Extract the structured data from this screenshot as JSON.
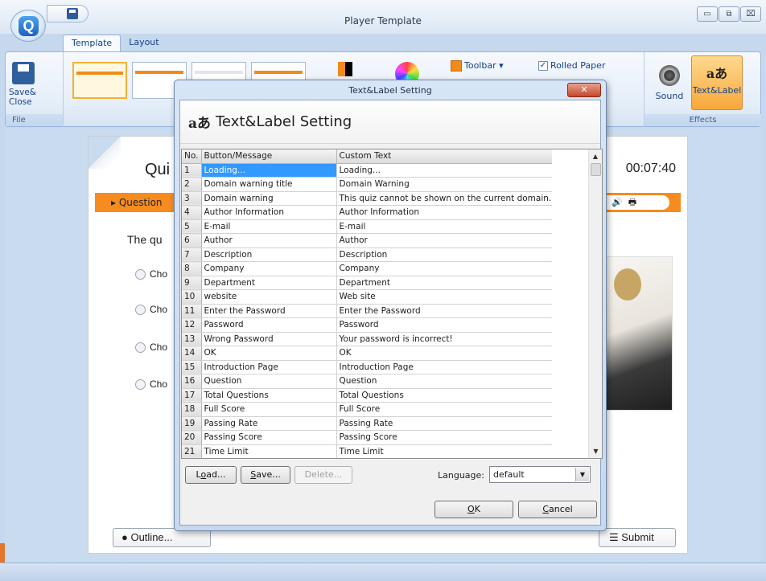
{
  "window": {
    "title": "Player Template",
    "controls": [
      "minimize",
      "restore",
      "close"
    ]
  },
  "ribbon": {
    "tabs": [
      "Template",
      "Layout"
    ],
    "active_tab": "Template",
    "file_group": {
      "label": "File",
      "save_close": "Save&\nClose"
    },
    "toolbar_label": "Toolbar",
    "rolled_paper": "Rolled Paper",
    "rolled_paper_checked": true,
    "effects_group": {
      "label": "Effects",
      "sound": "Sound",
      "text_label": "Text&Label"
    }
  },
  "player": {
    "title_partial": "Qui",
    "timer": "00:07:40",
    "question_partial": "Question",
    "question_text_partial": "The qu",
    "choices": [
      "Cho",
      "Cho",
      "Cho",
      "Cho"
    ],
    "outline_button": "Outline...",
    "submit_button": "Submit"
  },
  "dialog": {
    "window_title": "Text&Label Setting",
    "header_title": "Text&Label Setting",
    "header_icon": "translate-icon",
    "columns": [
      "No.",
      "Button/Message",
      "Custom Text"
    ],
    "selected_row": 1,
    "rows": [
      {
        "no": "1",
        "message": "Loading...",
        "custom": "Loading..."
      },
      {
        "no": "2",
        "message": "Domain warning title",
        "custom": "Domain Warning"
      },
      {
        "no": "3",
        "message": "Domain warning",
        "custom": "This quiz cannot be shown on the current domain."
      },
      {
        "no": "4",
        "message": "Author Information",
        "custom": "Author Information"
      },
      {
        "no": "5",
        "message": "E-mail",
        "custom": "E-mail"
      },
      {
        "no": "6",
        "message": "Author",
        "custom": "Author"
      },
      {
        "no": "7",
        "message": "Description",
        "custom": "Description"
      },
      {
        "no": "8",
        "message": "Company",
        "custom": "Company"
      },
      {
        "no": "9",
        "message": "Department",
        "custom": "Department"
      },
      {
        "no": "10",
        "message": "website",
        "custom": "Web site"
      },
      {
        "no": "11",
        "message": "Enter the Password",
        "custom": "Enter the Password"
      },
      {
        "no": "12",
        "message": "Password",
        "custom": "Password"
      },
      {
        "no": "13",
        "message": "Wrong Password",
        "custom": "Your password is incorrect!"
      },
      {
        "no": "14",
        "message": "OK",
        "custom": "OK"
      },
      {
        "no": "15",
        "message": "Introduction Page",
        "custom": "Introduction Page"
      },
      {
        "no": "16",
        "message": "Question",
        "custom": "Question"
      },
      {
        "no": "17",
        "message": "Total Questions",
        "custom": "Total Questions"
      },
      {
        "no": "18",
        "message": "Full Score",
        "custom": "Full Score"
      },
      {
        "no": "19",
        "message": "Passing Rate",
        "custom": "Passing Rate"
      },
      {
        "no": "20",
        "message": "Passing Score",
        "custom": "Passing Score"
      },
      {
        "no": "21",
        "message": "Time Limit",
        "custom": "Time Limit"
      }
    ],
    "buttons": {
      "load_pre": "L",
      "load_u": "o",
      "load_post": "ad...",
      "save_pre": "",
      "save_u": "S",
      "save_post": "ave...",
      "delete": "Delete...",
      "ok_u": "O",
      "ok_post": "K",
      "cancel_u": "C",
      "cancel_post": "ancel"
    },
    "language_label": "Language:",
    "language_value": "default"
  }
}
